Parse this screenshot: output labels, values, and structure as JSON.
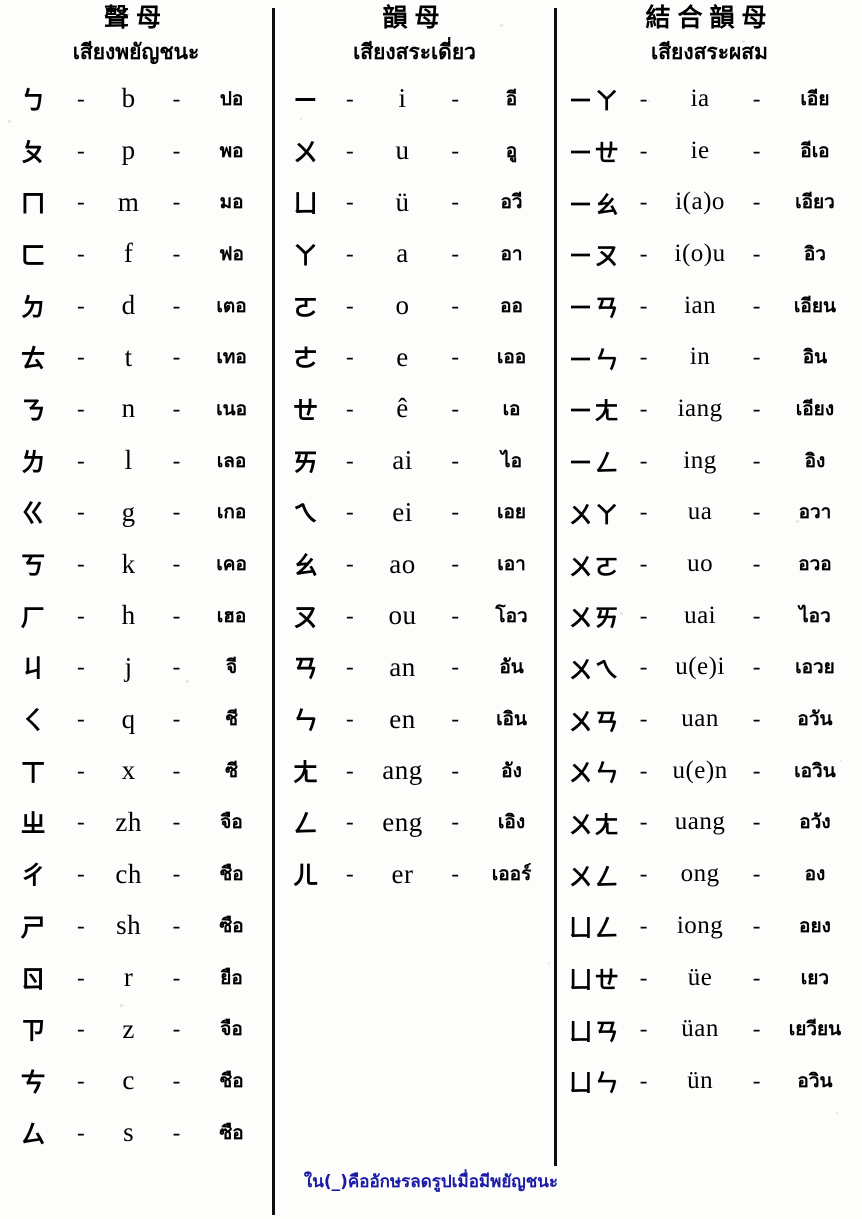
{
  "colors": {
    "ink": "#000000",
    "paper": "#fdfdfb",
    "footnote": "#1a1aa8"
  },
  "columns": [
    {
      "id": "initials",
      "heading_cn": "聲母",
      "heading_th": "เสียงพยัญชนะ",
      "separator": "-",
      "rows": [
        {
          "zhuyin": "ㄅ",
          "latin": "b",
          "thai": "ปอ"
        },
        {
          "zhuyin": "ㄆ",
          "latin": "p",
          "thai": "พอ"
        },
        {
          "zhuyin": "ㄇ",
          "latin": "m",
          "thai": "มอ"
        },
        {
          "zhuyin": "ㄈ",
          "latin": "f",
          "thai": "ฟอ"
        },
        {
          "zhuyin": "ㄉ",
          "latin": "d",
          "thai": "เตอ"
        },
        {
          "zhuyin": "ㄊ",
          "latin": "t",
          "thai": "เทอ"
        },
        {
          "zhuyin": "ㄋ",
          "latin": "n",
          "thai": "เนอ"
        },
        {
          "zhuyin": "ㄌ",
          "latin": "l",
          "thai": "เลอ"
        },
        {
          "zhuyin": "ㄍ",
          "latin": "g",
          "thai": "เกอ"
        },
        {
          "zhuyin": "ㄎ",
          "latin": "k",
          "thai": "เคอ"
        },
        {
          "zhuyin": "ㄏ",
          "latin": "h",
          "thai": "เฮอ"
        },
        {
          "zhuyin": "ㄐ",
          "latin": "j",
          "thai": "จี"
        },
        {
          "zhuyin": "ㄑ",
          "latin": "q",
          "thai": "ชี"
        },
        {
          "zhuyin": "ㄒ",
          "latin": "x",
          "thai": "ซี"
        },
        {
          "zhuyin": "ㄓ",
          "latin": "zh",
          "thai": "จือ"
        },
        {
          "zhuyin": "ㄔ",
          "latin": "ch",
          "thai": "ชือ"
        },
        {
          "zhuyin": "ㄕ",
          "latin": "sh",
          "thai": "ซือ"
        },
        {
          "zhuyin": "ㄖ",
          "latin": "r",
          "thai": "ยือ"
        },
        {
          "zhuyin": "ㄗ",
          "latin": "z",
          "thai": "จือ"
        },
        {
          "zhuyin": "ㄘ",
          "latin": "c",
          "thai": "ชือ"
        },
        {
          "zhuyin": "ㄙ",
          "latin": "s",
          "thai": "ซือ"
        }
      ]
    },
    {
      "id": "finals",
      "heading_cn": "韻母",
      "heading_th": "เสียงสระเดี่ยว",
      "separator": "-",
      "rows": [
        {
          "zhuyin": "ㄧ",
          "latin": "i",
          "thai": "อี"
        },
        {
          "zhuyin": "ㄨ",
          "latin": "u",
          "thai": "อู"
        },
        {
          "zhuyin": "ㄩ",
          "latin": "ü",
          "thai": "อวี"
        },
        {
          "zhuyin": "ㄚ",
          "latin": "a",
          "thai": "อา"
        },
        {
          "zhuyin": "ㄛ",
          "latin": "o",
          "thai": "ออ"
        },
        {
          "zhuyin": "ㄜ",
          "latin": "e",
          "thai": "เออ"
        },
        {
          "zhuyin": "ㄝ",
          "latin": "ê",
          "thai": "เอ"
        },
        {
          "zhuyin": "ㄞ",
          "latin": "ai",
          "thai": "ไอ"
        },
        {
          "zhuyin": "ㄟ",
          "latin": "ei",
          "thai": "เอย"
        },
        {
          "zhuyin": "ㄠ",
          "latin": "ao",
          "thai": "เอา"
        },
        {
          "zhuyin": "ㄡ",
          "latin": "ou",
          "thai": "โอว"
        },
        {
          "zhuyin": "ㄢ",
          "latin": "an",
          "thai": "อัน"
        },
        {
          "zhuyin": "ㄣ",
          "latin": "en",
          "thai": "เอิน"
        },
        {
          "zhuyin": "ㄤ",
          "latin": "ang",
          "thai": "อัง"
        },
        {
          "zhuyin": "ㄥ",
          "latin": "eng",
          "thai": "เอิง"
        },
        {
          "zhuyin": "ㄦ",
          "latin": "er",
          "thai": "เออร์"
        }
      ]
    },
    {
      "id": "compound",
      "heading_cn": "結合韻母",
      "heading_th": "เสียงสระผสม",
      "separator": "-",
      "rows": [
        {
          "zhuyin": "ㄧㄚ",
          "latin": "ia",
          "thai": "เอีย"
        },
        {
          "zhuyin": "ㄧㄝ",
          "latin": "ie",
          "thai": "อีเอ"
        },
        {
          "zhuyin": "ㄧㄠ",
          "latin": "i(a)o",
          "thai": "เอียว"
        },
        {
          "zhuyin": "ㄧㄡ",
          "latin": "i(o)u",
          "thai": "อิว"
        },
        {
          "zhuyin": "ㄧㄢ",
          "latin": "ian",
          "thai": "เอียน"
        },
        {
          "zhuyin": "ㄧㄣ",
          "latin": "in",
          "thai": "อิน"
        },
        {
          "zhuyin": "ㄧㄤ",
          "latin": "iang",
          "thai": "เอียง"
        },
        {
          "zhuyin": "ㄧㄥ",
          "latin": "ing",
          "thai": "อิง"
        },
        {
          "zhuyin": "ㄨㄚ",
          "latin": "ua",
          "thai": "อวา"
        },
        {
          "zhuyin": "ㄨㄛ",
          "latin": "uo",
          "thai": "อวอ"
        },
        {
          "zhuyin": "ㄨㄞ",
          "latin": "uai",
          "thai": "ไอว"
        },
        {
          "zhuyin": "ㄨㄟ",
          "latin": "u(e)i",
          "thai": "เอวย"
        },
        {
          "zhuyin": "ㄨㄢ",
          "latin": "uan",
          "thai": "อวัน"
        },
        {
          "zhuyin": "ㄨㄣ",
          "latin": "u(e)n",
          "thai": "เอวิน"
        },
        {
          "zhuyin": "ㄨㄤ",
          "latin": "uang",
          "thai": "อวัง"
        },
        {
          "zhuyin": "ㄨㄥ",
          "latin": "ong",
          "thai": "อง"
        },
        {
          "zhuyin": "ㄩㄥ",
          "latin": "iong",
          "thai": "อยง"
        },
        {
          "zhuyin": "ㄩㄝ",
          "latin": "üe",
          "thai": "เยว"
        },
        {
          "zhuyin": "ㄩㄢ",
          "latin": "üan",
          "thai": "เยวียน"
        },
        {
          "zhuyin": "ㄩㄣ",
          "latin": "ün",
          "thai": "อวิน"
        }
      ]
    }
  ],
  "footnote": "ใน(_)คืออักษรลดรูปเมื่อมีพยัญชนะ"
}
